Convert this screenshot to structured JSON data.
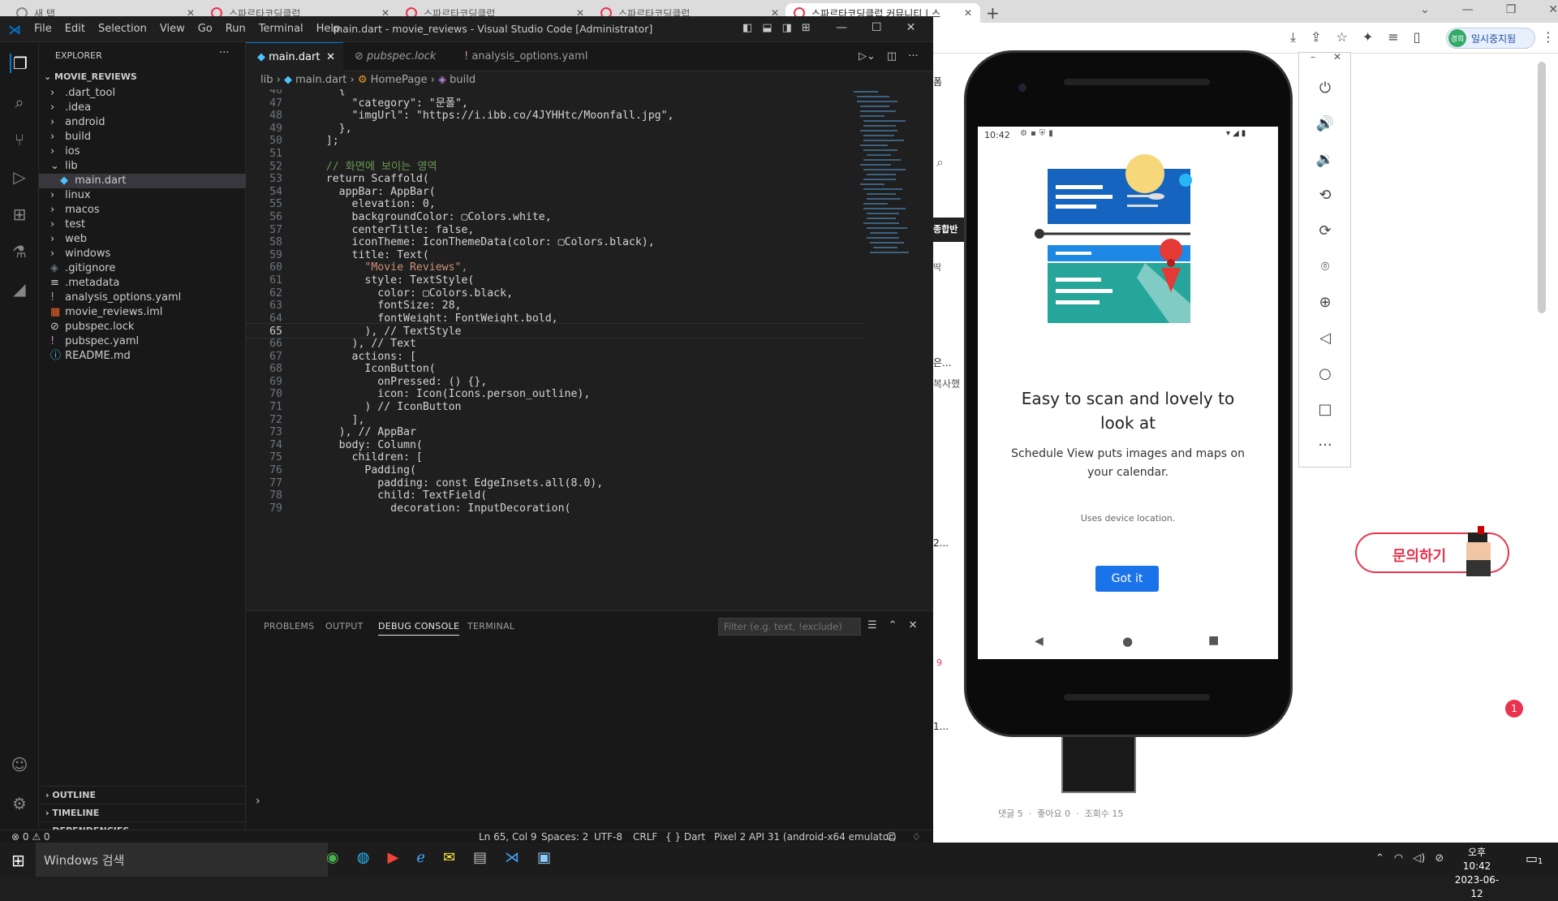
{
  "browser": {
    "tabs": [
      {
        "label": "새 탭"
      },
      {
        "label": "스파르타코딩클럽"
      },
      {
        "label": "스파르타코딩클럽"
      },
      {
        "label": "스파르타코딩클럽"
      },
      {
        "label": "스파르타코딩클럽 커뮤니티 | 스"
      }
    ],
    "profile_label": "일시중지됨",
    "profile_avatar": "경희"
  },
  "vscode": {
    "menu": [
      "File",
      "Edit",
      "Selection",
      "View",
      "Go",
      "Run",
      "Terminal",
      "Help"
    ],
    "window_title": "main.dart - movie_reviews - Visual Studio Code [Administrator]",
    "explorer_title": "EXPLORER",
    "project": "MOVIE_REVIEWS",
    "tree": [
      {
        "label": ".dart_tool",
        "type": "folder",
        "depth": 0
      },
      {
        "label": ".idea",
        "type": "folder",
        "depth": 0
      },
      {
        "label": "android",
        "type": "folder",
        "depth": 0
      },
      {
        "label": "build",
        "type": "folder",
        "depth": 0
      },
      {
        "label": "ios",
        "type": "folder",
        "depth": 0
      },
      {
        "label": "lib",
        "type": "folder-open",
        "depth": 0
      },
      {
        "label": "main.dart",
        "type": "dart",
        "depth": 1,
        "selected": true
      },
      {
        "label": "linux",
        "type": "folder",
        "depth": 0
      },
      {
        "label": "macos",
        "type": "folder",
        "depth": 0
      },
      {
        "label": "test",
        "type": "folder",
        "depth": 0
      },
      {
        "label": "web",
        "type": "folder",
        "depth": 0
      },
      {
        "label": "windows",
        "type": "folder",
        "depth": 0
      },
      {
        "label": ".gitignore",
        "type": "git",
        "depth": 0
      },
      {
        "label": ".metadata",
        "type": "meta",
        "depth": 0
      },
      {
        "label": "analysis_options.yaml",
        "type": "yaml",
        "depth": 0
      },
      {
        "label": "movie_reviews.iml",
        "type": "iml",
        "depth": 0
      },
      {
        "label": "pubspec.lock",
        "type": "lock",
        "depth": 0
      },
      {
        "label": "pubspec.yaml",
        "type": "yaml",
        "depth": 0
      },
      {
        "label": "README.md",
        "type": "info",
        "depth": 0
      }
    ],
    "outline_sections": [
      "OUTLINE",
      "TIMELINE",
      "DEPENDENCIES"
    ],
    "tabs": [
      {
        "label": "main.dart",
        "active": true
      },
      {
        "label": "pubspec.lock",
        "active": false
      },
      {
        "label": "analysis_options.yaml",
        "active": false
      }
    ],
    "breadcrumb": [
      "lib",
      "main.dart",
      "HomePage",
      "build"
    ],
    "code_lines": [
      {
        "n": "46",
        "c": "      {"
      },
      {
        "n": "47",
        "c": "        \"category\": \"문폴\","
      },
      {
        "n": "48",
        "c": "        \"imgUrl\": \"https://i.ibb.co/4JYHHtc/Moonfall.jpg\","
      },
      {
        "n": "49",
        "c": "      },"
      },
      {
        "n": "50",
        "c": "    ];"
      },
      {
        "n": "51",
        "c": ""
      },
      {
        "n": "52",
        "c": "    // 화면에 보이는 영역"
      },
      {
        "n": "53",
        "c": "    return Scaffold("
      },
      {
        "n": "54",
        "c": "      appBar: AppBar("
      },
      {
        "n": "55",
        "c": "        elevation: 0,"
      },
      {
        "n": "56",
        "c": "        backgroundColor: ▢Colors.white,"
      },
      {
        "n": "57",
        "c": "        centerTitle: false,"
      },
      {
        "n": "58",
        "c": "        iconTheme: IconThemeData(color: ▢Colors.black),"
      },
      {
        "n": "59",
        "c": "        title: Text("
      },
      {
        "n": "60",
        "c": "          \"Movie Reviews\","
      },
      {
        "n": "61",
        "c": "          style: TextStyle("
      },
      {
        "n": "62",
        "c": "            color: ▢Colors.black,"
      },
      {
        "n": "63",
        "c": "            fontSize: 28,"
      },
      {
        "n": "64",
        "c": "            fontWeight: FontWeight.bold,"
      },
      {
        "n": "65",
        "c": "          ), // TextStyle"
      },
      {
        "n": "66",
        "c": "        ), // Text"
      },
      {
        "n": "67",
        "c": "        actions: ["
      },
      {
        "n": "68",
        "c": "          IconButton("
      },
      {
        "n": "69",
        "c": "            onPressed: () {},"
      },
      {
        "n": "70",
        "c": "            icon: Icon(Icons.person_outline),"
      },
      {
        "n": "71",
        "c": "          ) // IconButton"
      },
      {
        "n": "72",
        "c": "        ],"
      },
      {
        "n": "73",
        "c": "      ), // AppBar"
      },
      {
        "n": "74",
        "c": "      body: Column("
      },
      {
        "n": "75",
        "c": "        children: ["
      },
      {
        "n": "76",
        "c": "          Padding("
      },
      {
        "n": "77",
        "c": "            padding: const EdgeInsets.all(8.0),"
      },
      {
        "n": "78",
        "c": "            child: TextField("
      },
      {
        "n": "79",
        "c": "              decoration: InputDecoration("
      }
    ],
    "current_line": "65",
    "panel_tabs": [
      "PROBLEMS",
      "OUTPUT",
      "DEBUG CONSOLE",
      "TERMINAL"
    ],
    "panel_active": "DEBUG CONSOLE",
    "filter_placeholder": "Filter (e.g. text, !exclude)",
    "status": {
      "errors": "0",
      "warnings": "0",
      "position": "Ln 65, Col 9",
      "spaces": "Spaces: 2",
      "encoding": "UTF-8",
      "eol": "CRLF",
      "language": "Dart",
      "device": "Pixel 2 API 31 (android-x64 emulator)"
    }
  },
  "emulator": {
    "time": "10:42",
    "heading": "Easy to scan and lovely to look at",
    "body": "Schedule View puts images and maps on your calendar.",
    "note": "Uses device location.",
    "button": "Got it"
  },
  "web": {
    "partial_texts": [
      "폼",
      "종합반",
      "딱",
      "은...",
      "복사했",
      "2...",
      "1...",
      "9"
    ],
    "inquiry_button": "문의하기",
    "badge_count": "1",
    "footer": "댓글 5  ·  좋아요 0  ·  조회수 15"
  },
  "taskbar": {
    "search_placeholder": "Windows 검색",
    "time": "오후 10:42",
    "date": "2023-06-12",
    "notif_count": "1"
  },
  "colors": {
    "accent": "#0078d4",
    "button_blue": "#1a73e8",
    "brand_red": "#e8344e"
  }
}
